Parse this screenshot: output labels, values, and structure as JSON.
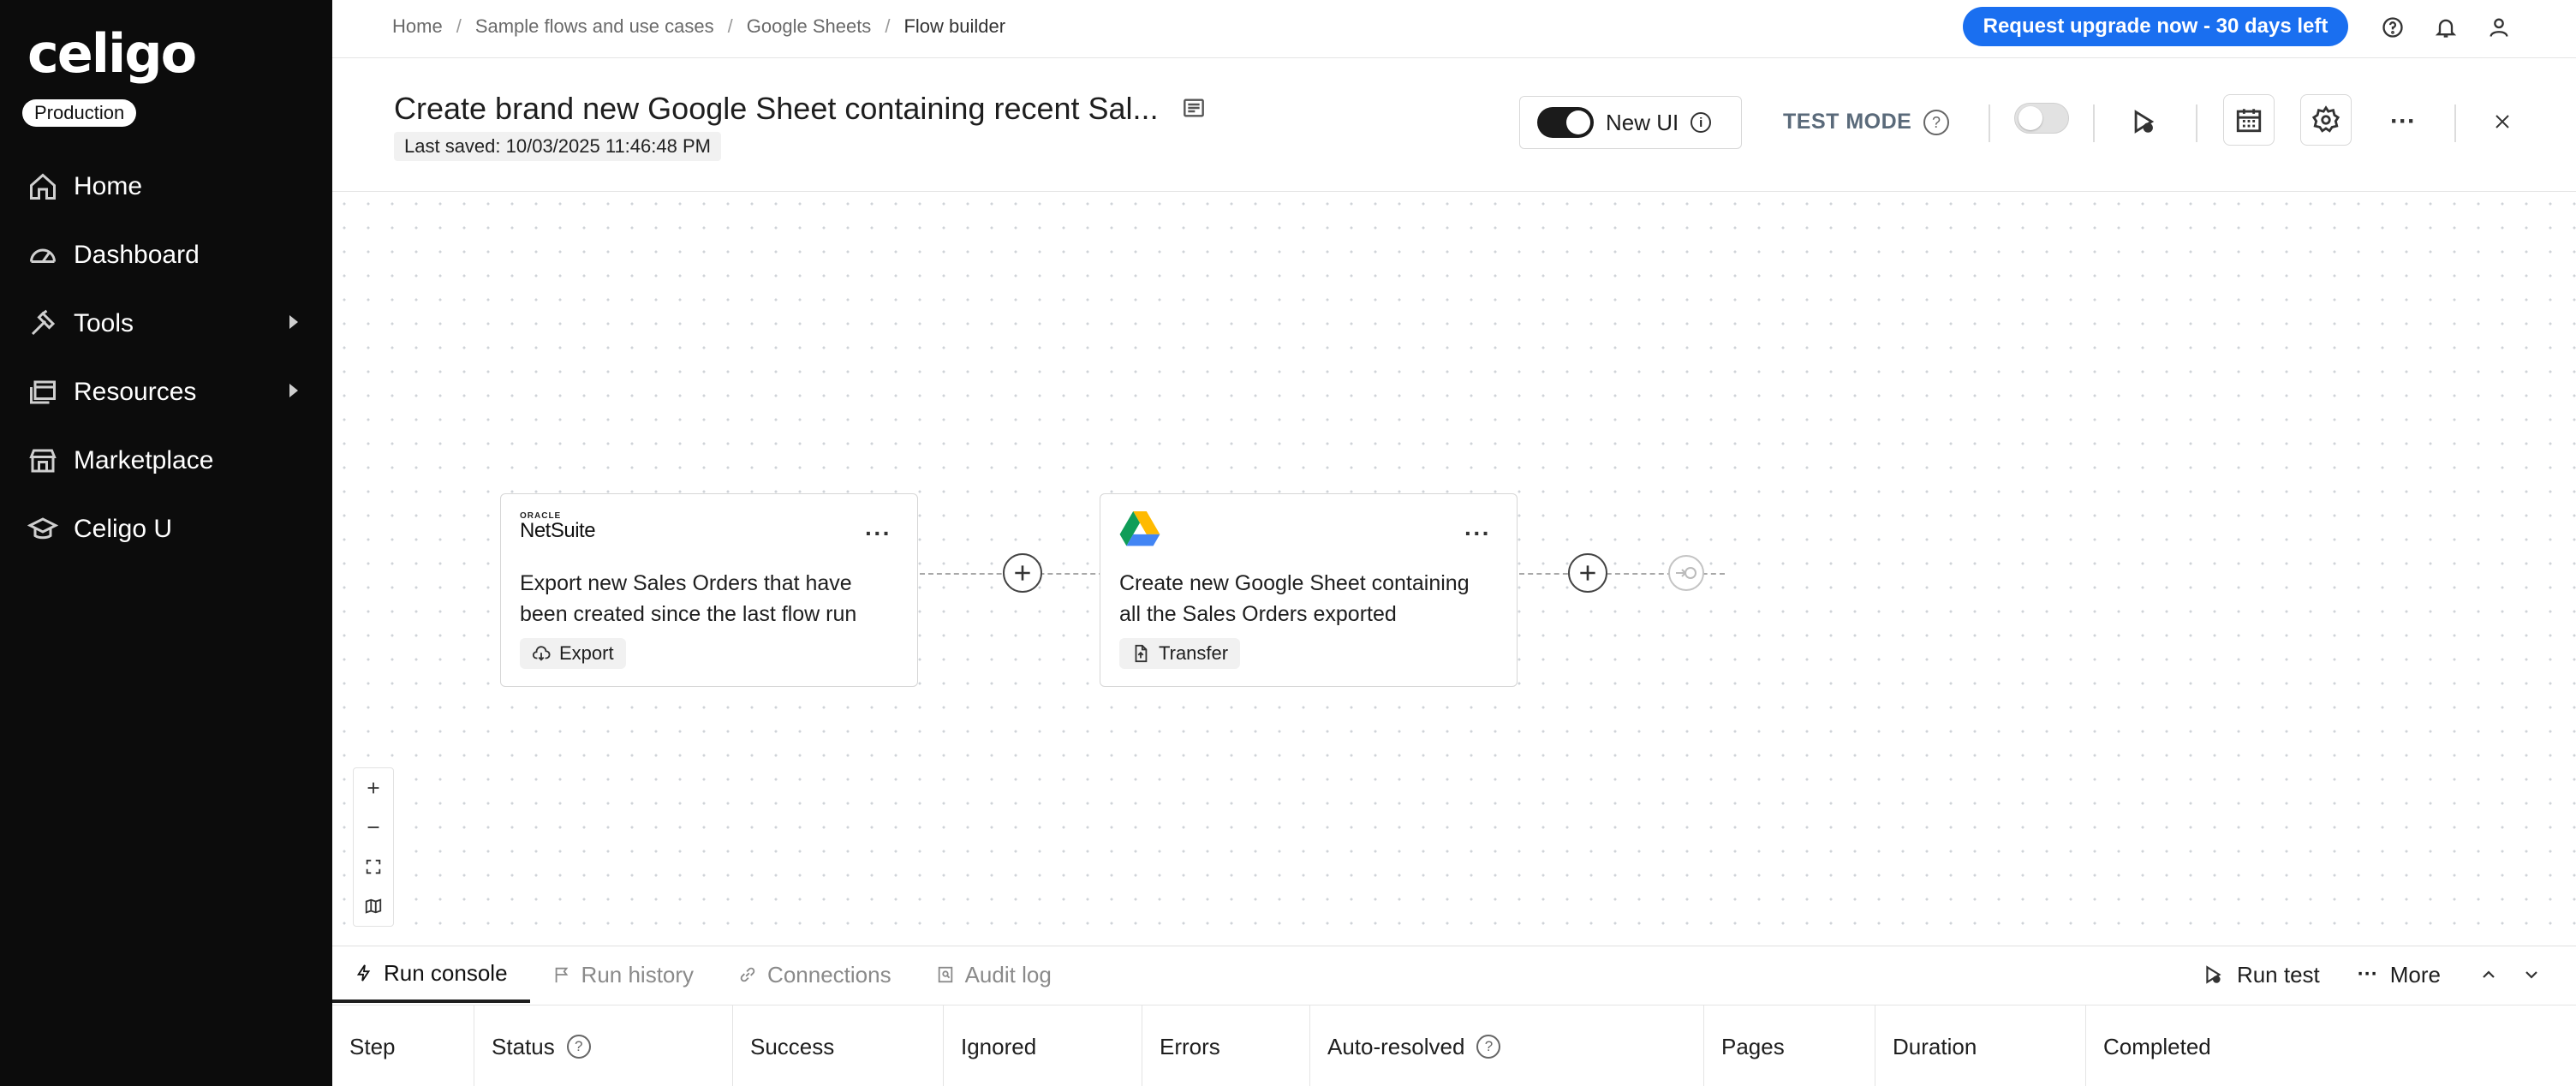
{
  "app": {
    "logo": "celigo",
    "environment": "Production"
  },
  "sidebar": {
    "items": [
      {
        "label": "Home",
        "icon": "home-icon"
      },
      {
        "label": "Dashboard",
        "icon": "dashboard-icon"
      },
      {
        "label": "Tools",
        "icon": "tools-icon",
        "has_submenu": true
      },
      {
        "label": "Resources",
        "icon": "resources-icon",
        "has_submenu": true
      },
      {
        "label": "Marketplace",
        "icon": "marketplace-icon"
      },
      {
        "label": "Celigo U",
        "icon": "graduation-cap-icon"
      }
    ]
  },
  "topbar": {
    "breadcrumb": [
      "Home",
      "Sample flows and use cases",
      "Google Sheets",
      "Flow builder"
    ],
    "upgrade_label": "Request upgrade now - 30 days left",
    "icons": [
      "help-icon",
      "bell-icon",
      "user-icon"
    ]
  },
  "flow": {
    "title": "Create brand new Google Sheet containing recent Sal...",
    "last_saved": "Last saved: 10/03/2025 11:46:48 PM",
    "new_ui_label": "New UI",
    "new_ui_enabled": true,
    "test_mode_label": "TEST MODE",
    "test_mode_enabled": false
  },
  "canvas": {
    "steps": [
      {
        "app": "NetSuite",
        "app_brand_top": "ORACLE",
        "app_brand": "NetSuite",
        "description": "Export new Sales Orders that have been created since the last flow run",
        "type": "Export"
      },
      {
        "app": "Google Drive",
        "description": "Create new Google Sheet containing all the Sales Orders exported",
        "type": "Transfer"
      }
    ],
    "more_label": "···"
  },
  "bottom_panel": {
    "tabs": [
      {
        "label": "Run console",
        "active": true
      },
      {
        "label": "Run history",
        "active": false
      },
      {
        "label": "Connections",
        "active": false
      },
      {
        "label": "Audit log",
        "active": false
      }
    ],
    "actions": {
      "run_test": "Run test",
      "more": "More"
    },
    "columns": [
      "Step",
      "Status",
      "Success",
      "Ignored",
      "Errors",
      "Auto-resolved",
      "Pages",
      "Duration",
      "Completed"
    ]
  },
  "colors": {
    "sidebar_bg": "#0c0c0c",
    "accent": "#1a6ff0"
  }
}
